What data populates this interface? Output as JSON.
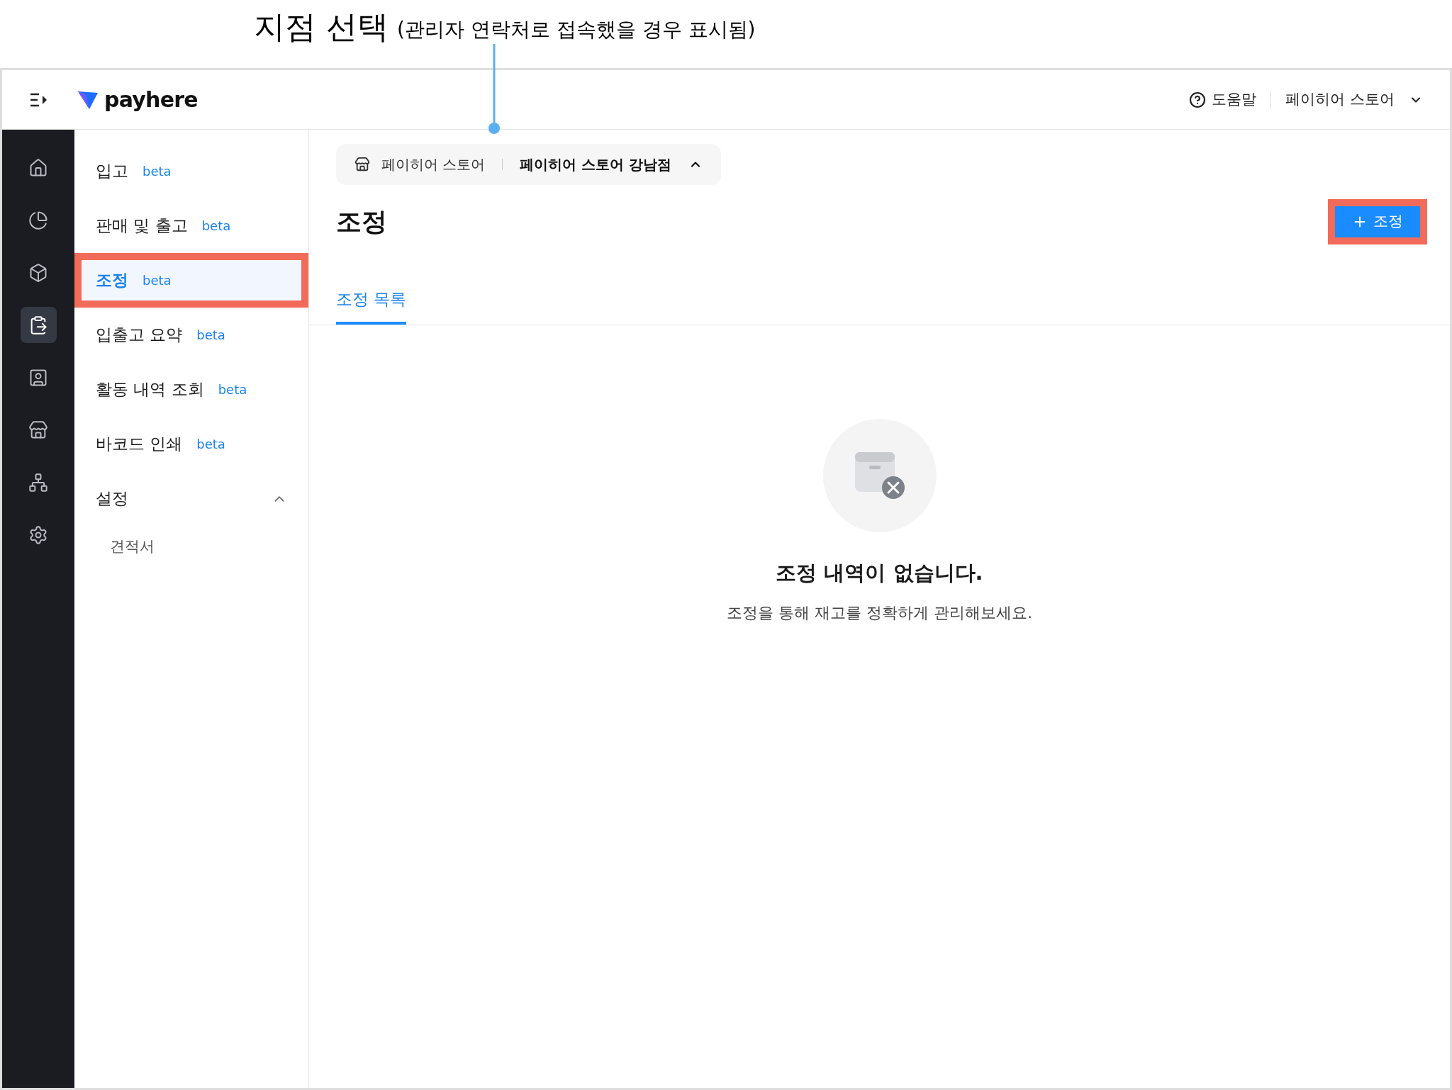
{
  "annotation": {
    "title": "지점 선택",
    "note": "(관리자 연락처로 접속했을 경우 표시됨)"
  },
  "header": {
    "logo": "payhere",
    "help": "도움말",
    "account": "페이히어 스토어"
  },
  "rail": [
    {
      "kind": "home",
      "selected": false
    },
    {
      "kind": "chart",
      "selected": false
    },
    {
      "kind": "box",
      "selected": false
    },
    {
      "kind": "clipboard",
      "selected": true
    },
    {
      "kind": "contact",
      "selected": false
    },
    {
      "kind": "store",
      "selected": false
    },
    {
      "kind": "network",
      "selected": false
    },
    {
      "kind": "settings",
      "selected": false
    }
  ],
  "submenu": [
    {
      "kind": "item",
      "label": "입고",
      "badge": "beta",
      "selected": false,
      "annotated": false
    },
    {
      "kind": "item",
      "label": "판매 및 출고",
      "badge": "beta",
      "selected": false,
      "annotated": false
    },
    {
      "kind": "item",
      "label": "조정",
      "badge": "beta",
      "selected": true,
      "annotated": true
    },
    {
      "kind": "item",
      "label": "입출고 요약",
      "badge": "beta",
      "selected": false,
      "annotated": false
    },
    {
      "kind": "item",
      "label": "활동 내역 조회",
      "badge": "beta",
      "selected": false,
      "annotated": false
    },
    {
      "kind": "item",
      "label": "바코드 인쇄",
      "badge": "beta",
      "selected": false,
      "annotated": false
    },
    {
      "kind": "group",
      "label": "설정",
      "expanded": true,
      "children": [
        {
          "label": "견적서"
        }
      ]
    }
  ],
  "store_selector": {
    "brand": "페이히어 스토어",
    "branch": "페이히어 스토어 강남점",
    "expanded": true
  },
  "page": {
    "title": "조정",
    "add_button": {
      "label": "조정",
      "annotated": true
    }
  },
  "tabs": [
    {
      "label": "조정 목록",
      "selected": true
    }
  ],
  "empty_state": {
    "title": "조정 내역이 없습니다.",
    "message": "조정을 통해 재고를 정확하게 관리해보세요."
  }
}
